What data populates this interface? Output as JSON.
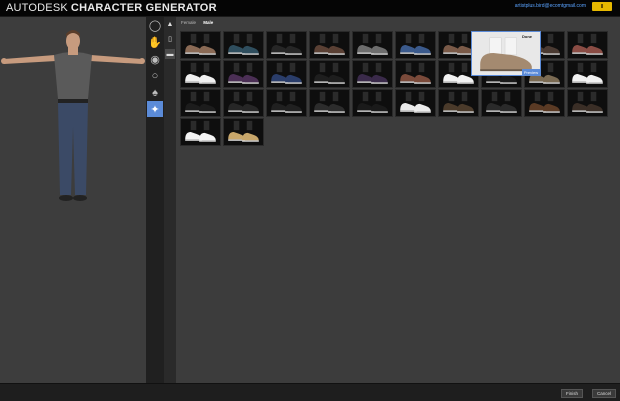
{
  "header": {
    "brand_prefix": "AUTODESK",
    "brand_suffix": "CHARACTER GENERATOR",
    "user_email": "artistplus.bird@ecomtgmail.com"
  },
  "rail": {
    "items": [
      {
        "icon": "face-shield-icon"
      },
      {
        "icon": "hand-icon"
      },
      {
        "icon": "eye-icon"
      },
      {
        "icon": "torso-icon"
      },
      {
        "icon": "figure-icon"
      },
      {
        "icon": "clothing-icon",
        "active": true
      }
    ]
  },
  "subrail": {
    "items": [
      {
        "icon": "shirt-icon"
      },
      {
        "icon": "pants-icon"
      },
      {
        "icon": "shoe-icon",
        "active": true
      }
    ]
  },
  "tabs": [
    {
      "label": "Female"
    },
    {
      "label": "Male",
      "active": true
    }
  ],
  "shoe_grid": {
    "rows": [
      [
        "#8a6a55",
        "#2f4e5e",
        "#262626",
        "#5a4034",
        "#6d6d6d",
        "#3b5a8c",
        "#7a5a48",
        "#d7d0c4",
        "#4a3a32",
        "#8a4c44"
      ],
      [
        "#f0f0f0",
        "#4b2f55",
        "#2a3d6a",
        "#1e1e1e",
        "#3a2a4a",
        "#7a4a3a",
        "#f2f2f2",
        "#1a1a1a",
        "#7a6a52",
        "#f2f2f2"
      ],
      [
        "#1c1c1c",
        "#262626",
        "#202020",
        "#2c2c2c",
        "#1a1a1a",
        "#ececec",
        "#4a3a2a",
        "#2a2a2a",
        "#5a3a24",
        "#3a2e26"
      ],
      [
        "#f4f4f4",
        "#c7a66a"
      ]
    ]
  },
  "preview": {
    "label": "Done",
    "tag": "Preview",
    "color": "#a48a70"
  },
  "footer": {
    "finish_label": "Finish",
    "cancel_label": "Cancel"
  }
}
